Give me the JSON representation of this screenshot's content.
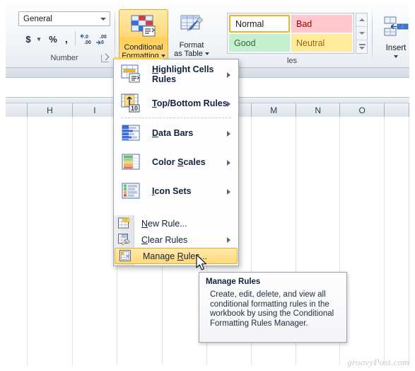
{
  "ribbon": {
    "number_group": {
      "label": "Number",
      "format_value": "General",
      "format_placeholder": "General",
      "buttons": [
        {
          "name": "currency",
          "label": "$"
        },
        {
          "name": "currency-dropdown",
          "label": "▾"
        },
        {
          "name": "percent",
          "label": "%"
        },
        {
          "name": "comma",
          "label": ","
        },
        {
          "name": "increase-decimal",
          "label": ".00"
        },
        {
          "name": "decrease-decimal",
          "label": ".00"
        }
      ],
      "dialog_launcher": "dialog-box-launcher-icon"
    },
    "styles_group": {
      "label": "les",
      "full_label": "Styles",
      "conditional_formatting": {
        "line1": "Conditional",
        "line2": "Formatting",
        "icon": "conditional-formatting-icon",
        "state": "pressed"
      },
      "format_as_table": {
        "line1": "Format",
        "line2": "as Table",
        "icon": "format-as-table-icon"
      },
      "cell_styles": [
        {
          "name": "normal",
          "label": "Normal",
          "bg": "#ffffff",
          "fg": "#1b1b1b",
          "selected": true
        },
        {
          "name": "bad",
          "label": "Bad",
          "bg": "#ffc7ce",
          "fg": "#9c0006",
          "selected": false
        },
        {
          "name": "good",
          "label": "Good",
          "bg": "#c6efce",
          "fg": "#276b3c",
          "selected": false
        },
        {
          "name": "neutral",
          "label": "Neutral",
          "bg": "#ffeb9c",
          "fg": "#9c6500",
          "selected": false
        }
      ],
      "gallery_scroll": [
        "scroll-up-icon",
        "scroll-down-icon",
        "more-styles-icon"
      ]
    },
    "insert_group": {
      "label": "Insert",
      "icon": "insert-cells-icon",
      "dropdown": "chevron-down-icon"
    }
  },
  "menu": {
    "name": "conditional-formatting-menu",
    "items": [
      {
        "id": "highlight-cells-rules",
        "label": "Highlight Cells Rules",
        "accel": "H",
        "icon": "highlight-cells-icon",
        "submenu": true
      },
      {
        "id": "top-bottom-rules",
        "label": "Top/Bottom Rules",
        "accel": "T",
        "icon": "top-bottom-rules-icon",
        "submenu": true
      },
      {
        "id": "data-bars",
        "label": "Data Bars",
        "accel": "D",
        "icon": "data-bars-icon",
        "submenu": true
      },
      {
        "id": "color-scales",
        "label": "Color Scales",
        "accel": "S",
        "icon": "color-scales-icon",
        "submenu": true
      },
      {
        "id": "icon-sets",
        "label": "Icon Sets",
        "accel": "I",
        "icon": "icon-sets-icon",
        "submenu": true
      }
    ],
    "bottom_items": [
      {
        "id": "new-rule",
        "label": "New Rule...",
        "accel": "N",
        "icon": "new-rule-icon",
        "submenu": false,
        "highlighted": false
      },
      {
        "id": "clear-rules",
        "label": "Clear Rules",
        "accel": "C",
        "icon": "clear-rules-icon",
        "submenu": true,
        "highlighted": false
      },
      {
        "id": "manage-rules",
        "label": "Manage Rules...",
        "accel": "R",
        "icon": "manage-rules-icon",
        "submenu": false,
        "highlighted": true
      }
    ]
  },
  "tooltip": {
    "title": "Manage Rules",
    "body": "Create, edit, delete, and view all conditional formatting rules in the workbook by using the Conditional Formatting Rules Manager."
  },
  "sheet": {
    "columns": [
      "",
      "H",
      "I",
      "",
      "",
      "",
      "M",
      "N",
      "O",
      ""
    ],
    "row_count": 18
  },
  "watermark": "groovyPost.com",
  "colors": {
    "accent_gold": "#ffce55",
    "highlight_border": "#e0ae37",
    "ribbon_bg": "#f2f4f7",
    "grid_line": "#dfe3e8"
  }
}
